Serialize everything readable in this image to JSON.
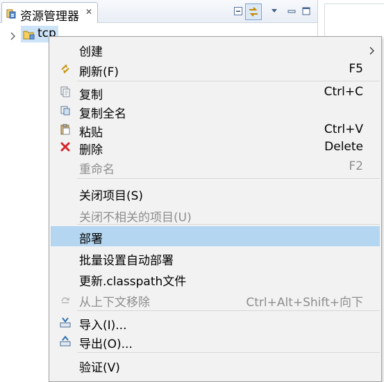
{
  "view": {
    "tab_title": "资源管理器",
    "tab_close": "✕",
    "tree": {
      "project_label": "tcp"
    }
  },
  "context_menu": {
    "create": {
      "label": "创建"
    },
    "refresh": {
      "label": "刷新(F)",
      "shortcut": "F5"
    },
    "copy": {
      "label": "复制",
      "shortcut": "Ctrl+C"
    },
    "copy_full_name": {
      "label": "复制全名"
    },
    "paste": {
      "label": "粘贴",
      "shortcut": "Ctrl+V"
    },
    "delete": {
      "label": "删除",
      "shortcut": "Delete"
    },
    "rename": {
      "label": "重命名",
      "shortcut": "F2"
    },
    "close_project": {
      "label": "关闭项目(S)"
    },
    "close_unrelated": {
      "label": "关闭不相关的项目(U)"
    },
    "deploy": {
      "label": "部署"
    },
    "batch_deploy": {
      "label": "批量设置自动部署"
    },
    "update_classpath": {
      "label": "更新.classpath文件"
    },
    "remove_context": {
      "label": "从上下文移除",
      "shortcut": "Ctrl+Alt+Shift+向下"
    },
    "import": {
      "label": "导入(I)..."
    },
    "export": {
      "label": "导出(O)..."
    },
    "validate": {
      "label": "验证(V)"
    }
  },
  "colors": {
    "highlight": "#b4d6f0",
    "disabled_text": "#8d8d8d",
    "menu_background": "#f2f2f2"
  },
  "icons": {
    "tab": "package-explorer-icon",
    "refresh": "refresh-icon",
    "copy": "copy-icon",
    "copy_full_name": "copy-qualified-name-icon",
    "paste": "paste-icon",
    "delete": "delete-x-icon",
    "remove_context": "remove-context-icon",
    "import": "import-icon",
    "export": "export-icon"
  }
}
